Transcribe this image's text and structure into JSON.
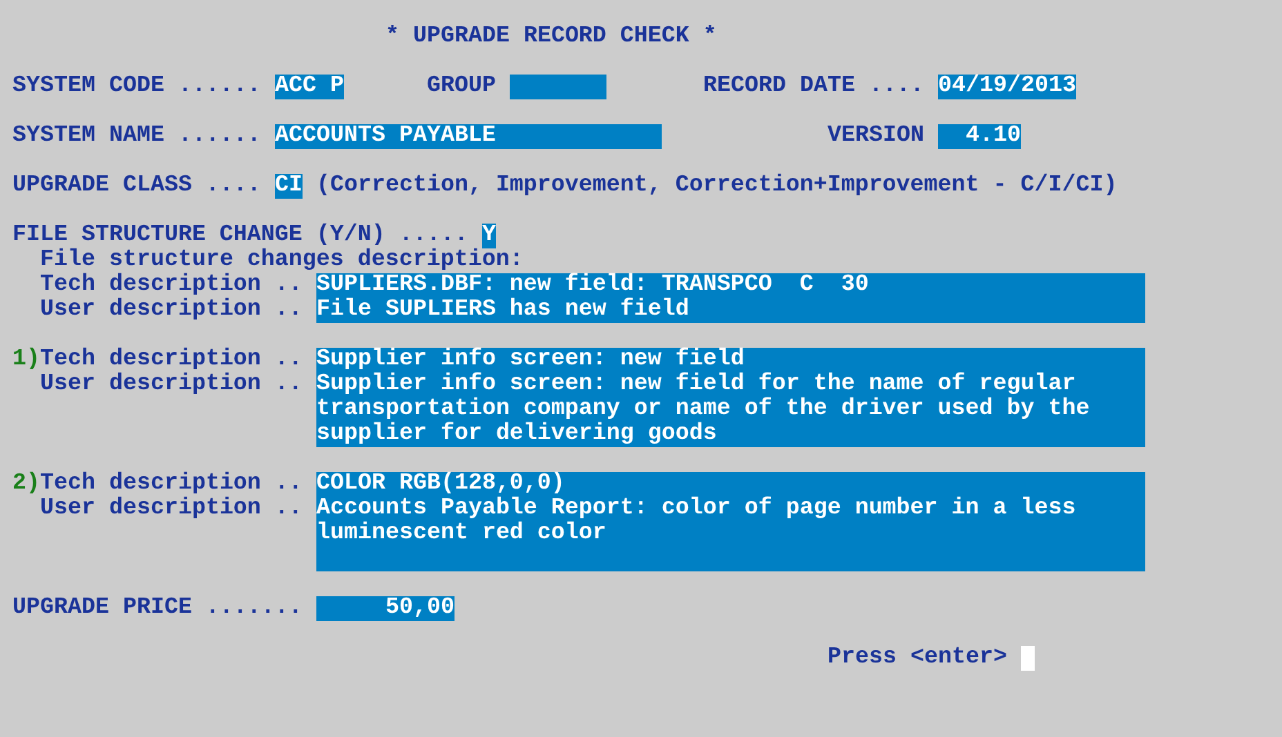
{
  "title": "* UPGRADE RECORD CHECK *",
  "system_code": {
    "label": "SYSTEM CODE ......",
    "value": "ACC P"
  },
  "group": {
    "label": "GROUP"
  },
  "record_date": {
    "label": "RECORD DATE ....",
    "value": "04/19/2013"
  },
  "system_name": {
    "label": "SYSTEM NAME ......",
    "value": "ACCOUNTS PAYABLE"
  },
  "version": {
    "label": "VERSION",
    "value": "4.10"
  },
  "upgrade_class": {
    "label": "UPGRADE CLASS ....",
    "value": "CI",
    "hint": "(Correction, Improvement, Correction+Improvement - C/I/CI)"
  },
  "file_structure_change": {
    "label": "FILE STRUCTURE CHANGE (Y/N) .....",
    "value": "Y"
  },
  "changes_heading": "File structure changes description:",
  "changes": [
    {
      "kind": "main",
      "tech_label": "Tech description ..",
      "tech": "SUPLIERS.DBF: new field: TRANSPCO  C  30",
      "user_label": "User description ..",
      "user": "File SUPLIERS has new field"
    },
    {
      "kind": "numbered",
      "number": "1)",
      "tech_label": "Tech description ..",
      "tech": "Supplier info screen: new field",
      "user_label": "User description ..",
      "user": "Supplier info screen: new field for the name of regular transportation company or name of the driver used by the supplier for delivering goods"
    },
    {
      "kind": "numbered",
      "number": "2)",
      "tech_label": "Tech description ..",
      "tech": "COLOR RGB(128,0,0)",
      "user_label": "User description ..",
      "user": "Accounts Payable Report: color of page number in a less luminescent red color"
    }
  ],
  "upgrade_price": {
    "label": "UPGRADE PRICE .......",
    "value": "50,00"
  },
  "prompt": "Press <enter>"
}
